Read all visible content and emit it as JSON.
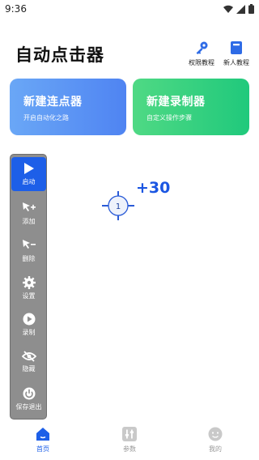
{
  "status": {
    "time": "9:36"
  },
  "header": {
    "title": "自动点击器"
  },
  "top_actions": {
    "permission_label": "权限教程",
    "newbie_label": "新人教程"
  },
  "cards": [
    {
      "title": "新建连点器",
      "subtitle": "开启自动化之路"
    },
    {
      "title": "新建录制器",
      "subtitle": "自定义操作步骤"
    }
  ],
  "toolbar": {
    "start": "启动",
    "add": "添加",
    "delete": "删除",
    "settings": "设置",
    "record": "录制",
    "hide": "隐藏",
    "save_exit": "保存退出"
  },
  "click_target": {
    "number": "1",
    "bonus": "+30"
  },
  "nav": {
    "home": "首页",
    "params": "参数",
    "mine": "我的"
  },
  "colors": {
    "accent": "#1d5fe8",
    "card_blue": "#5b93f4",
    "card_green": "#26cd80",
    "toolbar_bg": "#8e8e8e"
  }
}
